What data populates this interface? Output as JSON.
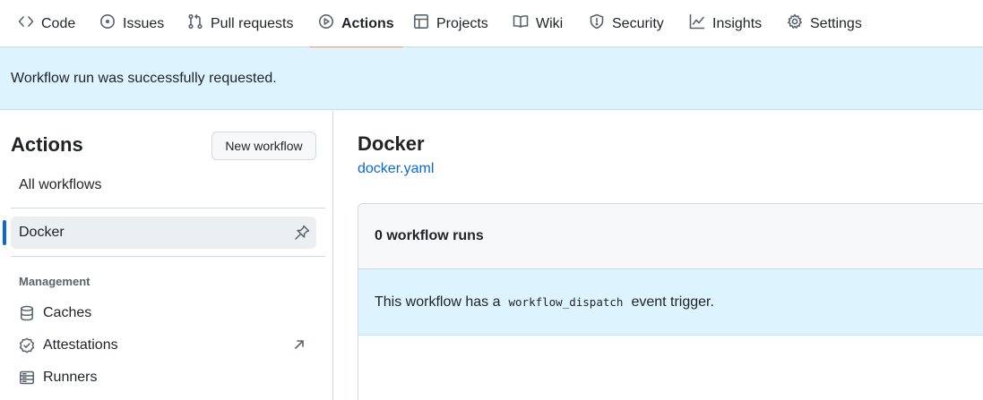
{
  "nav": {
    "tabs": [
      {
        "label": "Code",
        "icon": "code-icon"
      },
      {
        "label": "Issues",
        "icon": "issue-opened-icon"
      },
      {
        "label": "Pull requests",
        "icon": "git-pull-request-icon"
      },
      {
        "label": "Actions",
        "icon": "play-icon",
        "active": true
      },
      {
        "label": "Projects",
        "icon": "table-icon"
      },
      {
        "label": "Wiki",
        "icon": "book-icon"
      },
      {
        "label": "Security",
        "icon": "shield-icon"
      },
      {
        "label": "Insights",
        "icon": "graph-icon"
      },
      {
        "label": "Settings",
        "icon": "gear-icon"
      }
    ],
    "active_underline_color": "#fd8c73"
  },
  "flash": {
    "message": "Workflow run was successfully requested."
  },
  "sidebar": {
    "title": "Actions",
    "new_workflow_label": "New workflow",
    "all_workflows_label": "All workflows",
    "workflows": [
      {
        "label": "Docker",
        "selected": true,
        "icon": "pin-icon"
      }
    ],
    "management": {
      "heading": "Management",
      "items": [
        {
          "label": "Caches",
          "icon": "database-icon"
        },
        {
          "label": "Attestations",
          "icon": "verified-icon",
          "trailing_icon": "arrow-up-right-icon"
        },
        {
          "label": "Runners",
          "icon": "server-icon"
        }
      ]
    }
  },
  "main": {
    "workflow_title": "Docker",
    "workflow_file": "docker.yaml",
    "runs_count_label": "0 workflow runs",
    "trigger_notice": {
      "before": "This workflow has a",
      "code": "workflow_dispatch",
      "after": "event trigger."
    }
  },
  "colors": {
    "accent_blue": "#0969da",
    "flash_bg": "#ddf4ff",
    "border": "#d1d9e0"
  }
}
